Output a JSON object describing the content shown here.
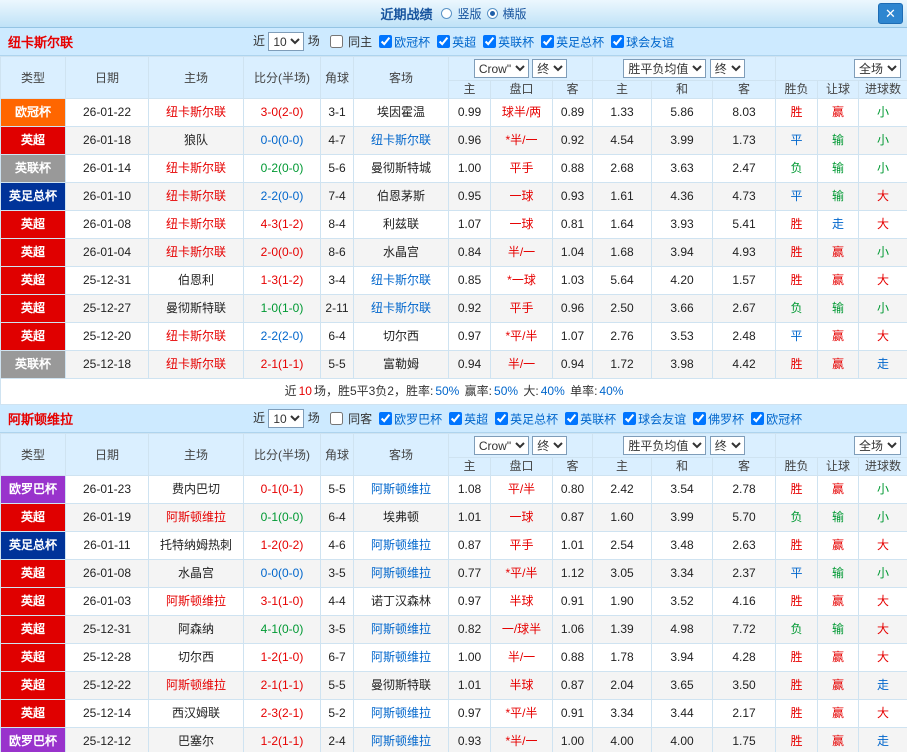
{
  "topbar": {
    "title": "近期战绩",
    "radios": [
      {
        "label": "竖版",
        "checked": false
      },
      {
        "label": "横版",
        "checked": true
      }
    ],
    "close": "✕"
  },
  "type_colors": {
    "欧冠杯": "#ff6600",
    "英超": "#e00000",
    "英联杯": "#999999",
    "英足总杯": "#003399",
    "欧罗巴杯": "#9933cc"
  },
  "controls": {
    "near_label": "近",
    "count": "10",
    "games_label": "场",
    "company": "Crow\"",
    "final": "终",
    "avg": "胜平负均值",
    "scope": "全场"
  },
  "columns": {
    "main": [
      "类型",
      "日期",
      "主场",
      "比分(半场)",
      "角球",
      "客场"
    ],
    "sub": [
      "主",
      "盘口",
      "客",
      "主",
      "和",
      "客",
      "胜负",
      "让球",
      "进球数"
    ]
  },
  "sections": [
    {
      "team": "纽卡斯尔联",
      "same_label": "同主",
      "same_checked": false,
      "filters": [
        {
          "label": "欧冠杯",
          "checked": true
        },
        {
          "label": "英超",
          "checked": true
        },
        {
          "label": "英联杯",
          "checked": true
        },
        {
          "label": "英足总杯",
          "checked": true
        },
        {
          "label": "球会友谊",
          "checked": true
        }
      ],
      "rows": [
        {
          "type": "欧冠杯",
          "date": "26-01-22",
          "home": "纽卡斯尔联",
          "home_cls": "red",
          "score": "3-0(2-0)",
          "score_cls": "red",
          "corner": "3-1",
          "away": "埃因霍温",
          "away_cls": "",
          "ah_home": "0.99",
          "ah_line": "球半/两",
          "ah_away": "0.89",
          "eu_home": "1.33",
          "eu_draw": "5.86",
          "eu_away": "8.03",
          "wdl": "胜",
          "wdl_cls": "red",
          "res_ah": "赢",
          "res_ah_cls": "red",
          "goals": "小",
          "goals_cls": "green"
        },
        {
          "type": "英超",
          "date": "26-01-18",
          "home": "狼队",
          "home_cls": "",
          "score": "0-0(0-0)",
          "score_cls": "blue",
          "corner": "4-7",
          "away": "纽卡斯尔联",
          "away_cls": "blue",
          "ah_home": "0.96",
          "ah_line": "*半/一",
          "ah_away": "0.92",
          "eu_home": "4.54",
          "eu_draw": "3.99",
          "eu_away": "1.73",
          "wdl": "平",
          "wdl_cls": "blue",
          "res_ah": "输",
          "res_ah_cls": "green",
          "goals": "小",
          "goals_cls": "green"
        },
        {
          "type": "英联杯",
          "date": "26-01-14",
          "home": "纽卡斯尔联",
          "home_cls": "red",
          "score": "0-2(0-0)",
          "score_cls": "green",
          "corner": "5-6",
          "away": "曼彻斯特城",
          "away_cls": "",
          "ah_home": "1.00",
          "ah_line": "平手",
          "ah_away": "0.88",
          "eu_home": "2.68",
          "eu_draw": "3.63",
          "eu_away": "2.47",
          "wdl": "负",
          "wdl_cls": "green",
          "res_ah": "输",
          "res_ah_cls": "green",
          "goals": "小",
          "goals_cls": "green"
        },
        {
          "type": "英足总杯",
          "date": "26-01-10",
          "home": "纽卡斯尔联",
          "home_cls": "red",
          "score": "2-2(0-0)",
          "score_cls": "blue",
          "corner": "7-4",
          "away": "伯恩茅斯",
          "away_cls": "",
          "ah_home": "0.95",
          "ah_line": "一球",
          "ah_away": "0.93",
          "eu_home": "1.61",
          "eu_draw": "4.36",
          "eu_away": "4.73",
          "wdl": "平",
          "wdl_cls": "blue",
          "res_ah": "输",
          "res_ah_cls": "green",
          "goals": "大",
          "goals_cls": "red"
        },
        {
          "type": "英超",
          "date": "26-01-08",
          "home": "纽卡斯尔联",
          "home_cls": "red",
          "score": "4-3(1-2)",
          "score_cls": "red",
          "corner": "8-4",
          "away": "利兹联",
          "away_cls": "",
          "ah_home": "1.07",
          "ah_line": "一球",
          "ah_away": "0.81",
          "eu_home": "1.64",
          "eu_draw": "3.93",
          "eu_away": "5.41",
          "wdl": "胜",
          "wdl_cls": "red",
          "res_ah": "走",
          "res_ah_cls": "blue",
          "goals": "大",
          "goals_cls": "red"
        },
        {
          "type": "英超",
          "date": "26-01-04",
          "home": "纽卡斯尔联",
          "home_cls": "red",
          "score": "2-0(0-0)",
          "score_cls": "red",
          "corner": "8-6",
          "away": "水晶宫",
          "away_cls": "",
          "ah_home": "0.84",
          "ah_line": "半/一",
          "ah_away": "1.04",
          "eu_home": "1.68",
          "eu_draw": "3.94",
          "eu_away": "4.93",
          "wdl": "胜",
          "wdl_cls": "red",
          "res_ah": "赢",
          "res_ah_cls": "red",
          "goals": "小",
          "goals_cls": "green"
        },
        {
          "type": "英超",
          "date": "25-12-31",
          "home": "伯恩利",
          "home_cls": "",
          "score": "1-3(1-2)",
          "score_cls": "red",
          "corner": "3-4",
          "away": "纽卡斯尔联",
          "away_cls": "blue",
          "ah_home": "0.85",
          "ah_line": "*一球",
          "ah_away": "1.03",
          "eu_home": "5.64",
          "eu_draw": "4.20",
          "eu_away": "1.57",
          "wdl": "胜",
          "wdl_cls": "red",
          "res_ah": "赢",
          "res_ah_cls": "red",
          "goals": "大",
          "goals_cls": "red"
        },
        {
          "type": "英超",
          "date": "25-12-27",
          "home": "曼彻斯特联",
          "home_cls": "",
          "score": "1-0(1-0)",
          "score_cls": "green",
          "corner": "2-11",
          "away": "纽卡斯尔联",
          "away_cls": "blue",
          "ah_home": "0.92",
          "ah_line": "平手",
          "ah_away": "0.96",
          "eu_home": "2.50",
          "eu_draw": "3.66",
          "eu_away": "2.67",
          "wdl": "负",
          "wdl_cls": "green",
          "res_ah": "输",
          "res_ah_cls": "green",
          "goals": "小",
          "goals_cls": "green"
        },
        {
          "type": "英超",
          "date": "25-12-20",
          "home": "纽卡斯尔联",
          "home_cls": "red",
          "score": "2-2(2-0)",
          "score_cls": "blue",
          "corner": "6-4",
          "away": "切尔西",
          "away_cls": "",
          "ah_home": "0.97",
          "ah_line": "*平/半",
          "ah_away": "1.07",
          "eu_home": "2.76",
          "eu_draw": "3.53",
          "eu_away": "2.48",
          "wdl": "平",
          "wdl_cls": "blue",
          "res_ah": "赢",
          "res_ah_cls": "red",
          "goals": "大",
          "goals_cls": "red"
        },
        {
          "type": "英联杯",
          "date": "25-12-18",
          "home": "纽卡斯尔联",
          "home_cls": "red",
          "score": "2-1(1-1)",
          "score_cls": "red",
          "corner": "5-5",
          "away": "富勒姆",
          "away_cls": "",
          "ah_home": "0.94",
          "ah_line": "半/一",
          "ah_away": "0.94",
          "eu_home": "1.72",
          "eu_draw": "3.98",
          "eu_away": "4.42",
          "wdl": "胜",
          "wdl_cls": "red",
          "res_ah": "赢",
          "res_ah_cls": "red",
          "goals": "走",
          "goals_cls": "blue"
        }
      ],
      "summary": [
        {
          "text": "近",
          "cls": ""
        },
        {
          "text": "10",
          "cls": "red"
        },
        {
          "text": "场，胜5平3负2，胜率:",
          "cls": ""
        },
        {
          "text": "50%",
          "cls": "blue"
        },
        {
          "text": " 赢率:",
          "cls": ""
        },
        {
          "text": "50%",
          "cls": "blue"
        },
        {
          "text": " 大:",
          "cls": ""
        },
        {
          "text": "40%",
          "cls": "blue"
        },
        {
          "text": " 单率:",
          "cls": ""
        },
        {
          "text": "40%",
          "cls": "blue"
        }
      ]
    },
    {
      "team": "阿斯顿维拉",
      "same_label": "同客",
      "same_checked": false,
      "filters": [
        {
          "label": "欧罗巴杯",
          "checked": true
        },
        {
          "label": "英超",
          "checked": true
        },
        {
          "label": "英足总杯",
          "checked": true
        },
        {
          "label": "英联杯",
          "checked": true
        },
        {
          "label": "球会友谊",
          "checked": true
        },
        {
          "label": "佛罗杯",
          "checked": true
        },
        {
          "label": "欧冠杯",
          "checked": true
        }
      ],
      "rows": [
        {
          "type": "欧罗巴杯",
          "date": "26-01-23",
          "home": "费内巴切",
          "home_cls": "",
          "score": "0-1(0-1)",
          "score_cls": "red",
          "corner": "5-5",
          "away": "阿斯顿维拉",
          "away_cls": "blue",
          "ah_home": "1.08",
          "ah_line": "平/半",
          "ah_away": "0.80",
          "eu_home": "2.42",
          "eu_draw": "3.54",
          "eu_away": "2.78",
          "wdl": "胜",
          "wdl_cls": "red",
          "res_ah": "赢",
          "res_ah_cls": "red",
          "goals": "小",
          "goals_cls": "green"
        },
        {
          "type": "英超",
          "date": "26-01-19",
          "home": "阿斯顿维拉",
          "home_cls": "red",
          "score": "0-1(0-0)",
          "score_cls": "green",
          "corner": "6-4",
          "away": "埃弗顿",
          "away_cls": "",
          "ah_home": "1.01",
          "ah_line": "一球",
          "ah_away": "0.87",
          "eu_home": "1.60",
          "eu_draw": "3.99",
          "eu_away": "5.70",
          "wdl": "负",
          "wdl_cls": "green",
          "res_ah": "输",
          "res_ah_cls": "green",
          "goals": "小",
          "goals_cls": "green"
        },
        {
          "type": "英足总杯",
          "date": "26-01-11",
          "home": "托特纳姆热刺",
          "home_cls": "",
          "score": "1-2(0-2)",
          "score_cls": "red",
          "corner": "4-6",
          "away": "阿斯顿维拉",
          "away_cls": "blue",
          "ah_home": "0.87",
          "ah_line": "平手",
          "ah_away": "1.01",
          "eu_home": "2.54",
          "eu_draw": "3.48",
          "eu_away": "2.63",
          "wdl": "胜",
          "wdl_cls": "red",
          "res_ah": "赢",
          "res_ah_cls": "red",
          "goals": "大",
          "goals_cls": "red"
        },
        {
          "type": "英超",
          "date": "26-01-08",
          "home": "水晶宫",
          "home_cls": "",
          "score": "0-0(0-0)",
          "score_cls": "blue",
          "corner": "3-5",
          "away": "阿斯顿维拉",
          "away_cls": "blue",
          "ah_home": "0.77",
          "ah_line": "*平/半",
          "ah_away": "1.12",
          "eu_home": "3.05",
          "eu_draw": "3.34",
          "eu_away": "2.37",
          "wdl": "平",
          "wdl_cls": "blue",
          "res_ah": "输",
          "res_ah_cls": "green",
          "goals": "小",
          "goals_cls": "green"
        },
        {
          "type": "英超",
          "date": "26-01-03",
          "home": "阿斯顿维拉",
          "home_cls": "red",
          "score": "3-1(1-0)",
          "score_cls": "red",
          "corner": "4-4",
          "away": "诺丁汉森林",
          "away_cls": "",
          "ah_home": "0.97",
          "ah_line": "半球",
          "ah_away": "0.91",
          "eu_home": "1.90",
          "eu_draw": "3.52",
          "eu_away": "4.16",
          "wdl": "胜",
          "wdl_cls": "red",
          "res_ah": "赢",
          "res_ah_cls": "red",
          "goals": "大",
          "goals_cls": "red"
        },
        {
          "type": "英超",
          "date": "25-12-31",
          "home": "阿森纳",
          "home_cls": "",
          "score": "4-1(0-0)",
          "score_cls": "green",
          "corner": "3-5",
          "away": "阿斯顿维拉",
          "away_cls": "blue",
          "ah_home": "0.82",
          "ah_line": "一/球半",
          "ah_away": "1.06",
          "eu_home": "1.39",
          "eu_draw": "4.98",
          "eu_away": "7.72",
          "wdl": "负",
          "wdl_cls": "green",
          "res_ah": "输",
          "res_ah_cls": "green",
          "goals": "大",
          "goals_cls": "red"
        },
        {
          "type": "英超",
          "date": "25-12-28",
          "home": "切尔西",
          "home_cls": "",
          "score": "1-2(1-0)",
          "score_cls": "red",
          "corner": "6-7",
          "away": "阿斯顿维拉",
          "away_cls": "blue",
          "ah_home": "1.00",
          "ah_line": "半/一",
          "ah_away": "0.88",
          "eu_home": "1.78",
          "eu_draw": "3.94",
          "eu_away": "4.28",
          "wdl": "胜",
          "wdl_cls": "red",
          "res_ah": "赢",
          "res_ah_cls": "red",
          "goals": "大",
          "goals_cls": "red"
        },
        {
          "type": "英超",
          "date": "25-12-22",
          "home": "阿斯顿维拉",
          "home_cls": "red",
          "score": "2-1(1-1)",
          "score_cls": "red",
          "corner": "5-5",
          "away": "曼彻斯特联",
          "away_cls": "",
          "ah_home": "1.01",
          "ah_line": "半球",
          "ah_away": "0.87",
          "eu_home": "2.04",
          "eu_draw": "3.65",
          "eu_away": "3.50",
          "wdl": "胜",
          "wdl_cls": "red",
          "res_ah": "赢",
          "res_ah_cls": "red",
          "goals": "走",
          "goals_cls": "blue"
        },
        {
          "type": "英超",
          "date": "25-12-14",
          "home": "西汉姆联",
          "home_cls": "",
          "score": "2-3(2-1)",
          "score_cls": "red",
          "corner": "5-2",
          "away": "阿斯顿维拉",
          "away_cls": "blue",
          "ah_home": "0.97",
          "ah_line": "*平/半",
          "ah_away": "0.91",
          "eu_home": "3.34",
          "eu_draw": "3.44",
          "eu_away": "2.17",
          "wdl": "胜",
          "wdl_cls": "red",
          "res_ah": "赢",
          "res_ah_cls": "red",
          "goals": "大",
          "goals_cls": "red"
        },
        {
          "type": "欧罗巴杯",
          "date": "25-12-12",
          "home": "巴塞尔",
          "home_cls": "",
          "score": "1-2(1-1)",
          "score_cls": "red",
          "corner": "2-4",
          "away": "阿斯顿维拉",
          "away_cls": "blue",
          "ah_home": "0.93",
          "ah_line": "*半/一",
          "ah_away": "1.00",
          "eu_home": "4.00",
          "eu_draw": "4.00",
          "eu_away": "1.75",
          "wdl": "胜",
          "wdl_cls": "red",
          "res_ah": "赢",
          "res_ah_cls": "red",
          "goals": "走",
          "goals_cls": "blue"
        }
      ]
    }
  ]
}
